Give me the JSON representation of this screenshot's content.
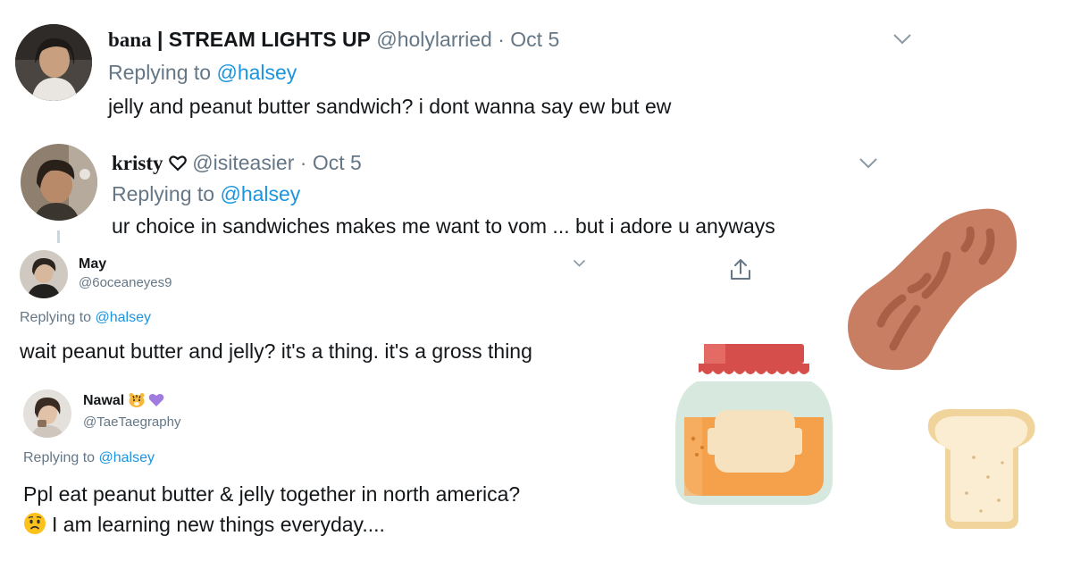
{
  "tweets": [
    {
      "name": "bana",
      "name_suffix": " | STREAM LIGHTS UP",
      "handle": "@holylarried",
      "sep": "·",
      "date": "Oct 5",
      "replying_prefix": "Replying to",
      "replying_handle": "@halsey",
      "text": "jelly and peanut butter sandwich? i dont wanna say ew but ew",
      "avatar_icon": "avatar-photo"
    },
    {
      "name": "kristy",
      "name_icon": "heart-outline-icon",
      "handle": "@isiteasier",
      "sep": "·",
      "date": "Oct 5",
      "replying_prefix": "Replying to",
      "replying_handle": "@halsey",
      "text": "ur choice in sandwiches makes me want to vom ... but i adore u anyways",
      "avatar_icon": "avatar-photo"
    },
    {
      "name": "May",
      "handle": "@6oceaneyes9",
      "replying_prefix": "Replying to",
      "replying_handle": "@halsey",
      "text": "wait peanut butter and jelly? it's a thing. it's a gross thing",
      "avatar_icon": "avatar-photo",
      "action_icon": "share-icon"
    },
    {
      "name": "Nawal",
      "name_emojis": "tiger-face-emoji purple-heart-emoji",
      "handle": "@TaeTaegraphy",
      "replying_prefix": "Replying to",
      "replying_handle": "@halsey",
      "text_line1": "Ppl eat peanut butter & jelly together in north america?",
      "text_line2": "I am learning new things everyday....",
      "line2_emoji": "worried-face-emoji",
      "avatar_icon": "avatar-photo"
    }
  ],
  "illustrations": [
    "peanut-icon",
    "jam-jar-icon",
    "bread-slice-icon"
  ],
  "colors": {
    "link_blue": "#1b95e0",
    "secondary_grey": "#657786",
    "peanut": "#c67c5f",
    "jar_lid": "#d9534f",
    "jam": "#f5a04a",
    "bread": "#f6e3bf"
  }
}
